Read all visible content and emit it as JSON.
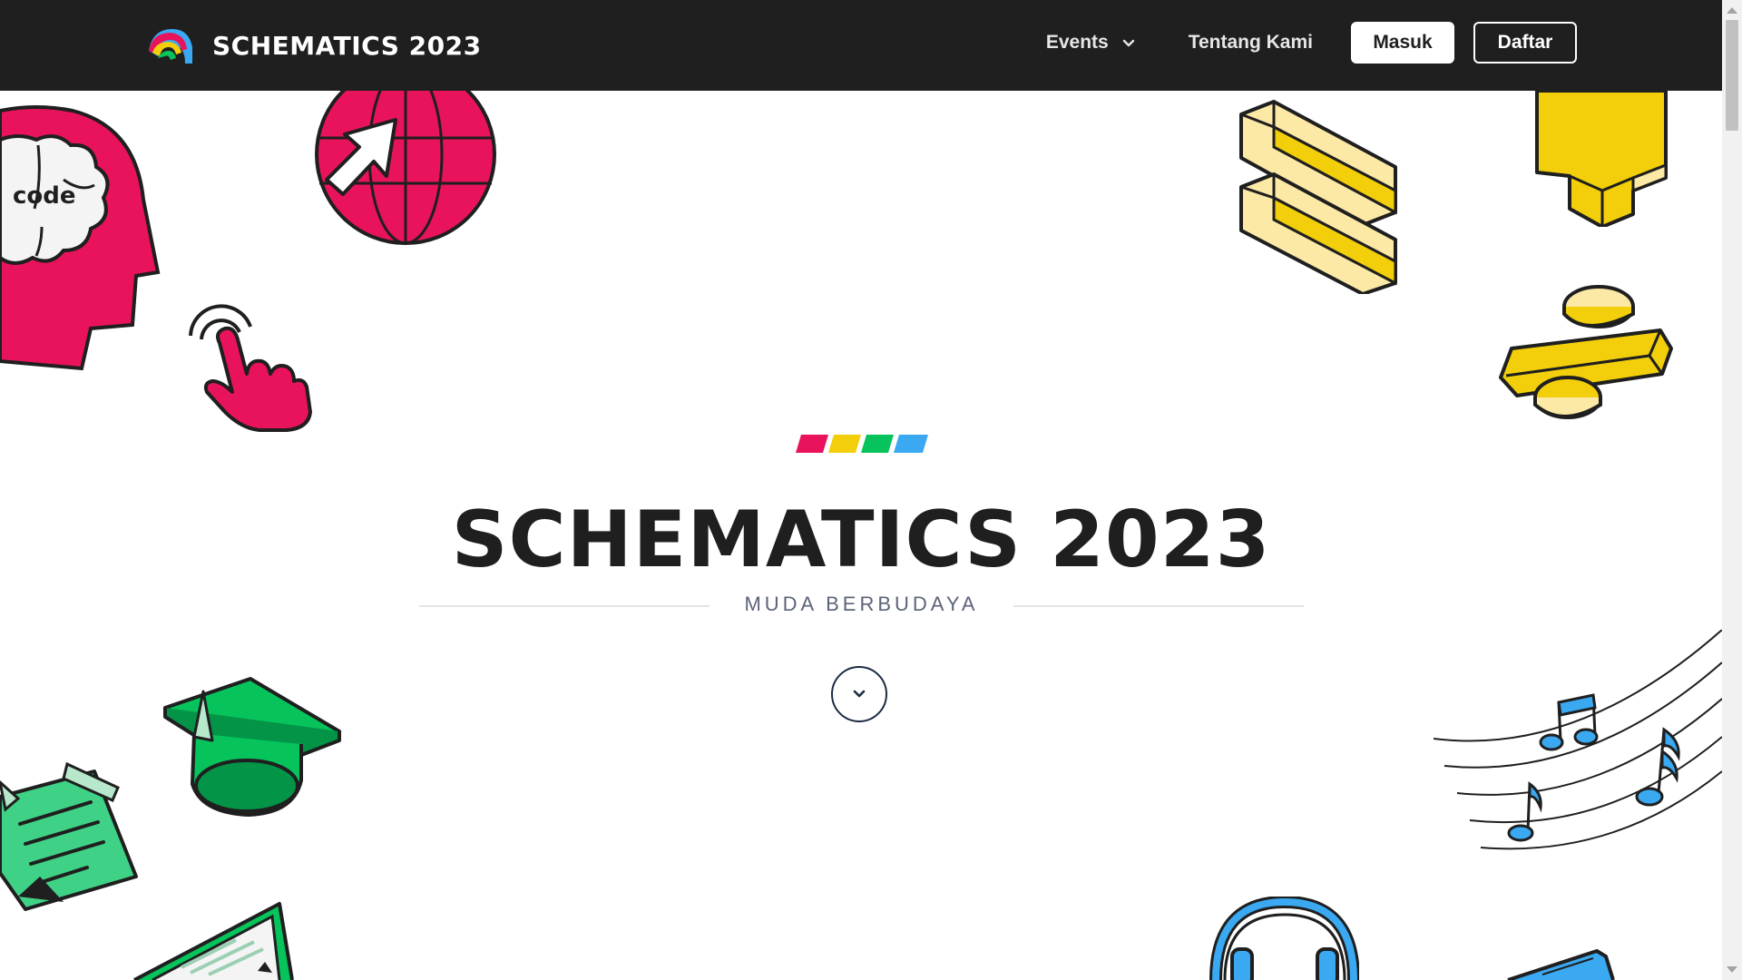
{
  "navbar": {
    "brand_name": "SCHEMATICS 2023",
    "menu": {
      "events_label": "Events",
      "about_label": "Tentang Kami",
      "login_label": "Masuk",
      "register_label": "Daftar"
    }
  },
  "hero": {
    "title": "SCHEMATICS 2023",
    "tagline": "MUDA BERBUDAYA",
    "color_bars": [
      "#e8135c",
      "#f2cf0a",
      "#07c35b",
      "#3aa9f2"
    ],
    "head_icon_label": "code"
  },
  "colors": {
    "navbar_bg": "#1f1f1f",
    "pink": "#e8135c",
    "yellow": "#f2cf0a",
    "light_yellow": "#fde9a6",
    "green": "#07c35b",
    "blue": "#3aa9f2",
    "text_dark": "#1f1f1f",
    "tagline_gray": "#5c6478"
  },
  "icons": [
    "brand-logo-icon",
    "chevron-down-icon",
    "head-code-icon",
    "globe-cursor-icon",
    "tap-hand-icon",
    "equals-blocks-icon",
    "plus-block-icon",
    "divide-block-icon",
    "graduation-cap-icon",
    "sticky-note-icon",
    "laptop-icon",
    "music-notes-icon",
    "headphones-icon",
    "book-icon"
  ]
}
